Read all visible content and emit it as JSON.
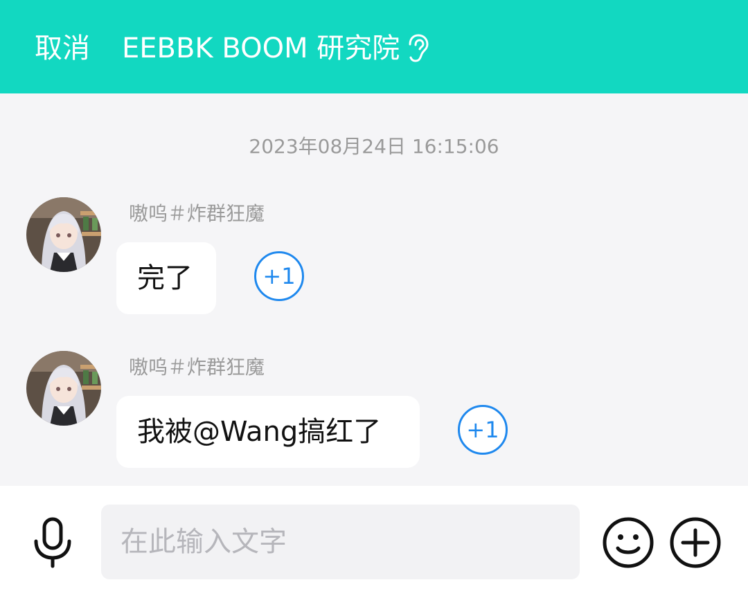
{
  "header": {
    "cancel_label": "取消",
    "title": "EEBBK BOOM 研究院",
    "ear_icon": "ear-icon"
  },
  "chat": {
    "timestamp": "2023年08月24日 16:15:06",
    "messages": [
      {
        "sender": "嗷呜＃炸群狂魔",
        "text": "完了",
        "plus_label": "+1",
        "avatar_icon": "anime-girl-avatar"
      },
      {
        "sender": "嗷呜＃炸群狂魔",
        "text": "我被@Wang搞红了",
        "plus_label": "+1",
        "avatar_icon": "anime-girl-avatar"
      }
    ]
  },
  "input_bar": {
    "placeholder": "在此输入文字",
    "mic_icon": "microphone-icon",
    "emoji_icon": "smiley-icon",
    "add_icon": "plus-circle-icon"
  },
  "colors": {
    "header_bg": "#12d8c1",
    "accent_blue": "#1e88ee",
    "page_bg": "#f5f5f7"
  }
}
